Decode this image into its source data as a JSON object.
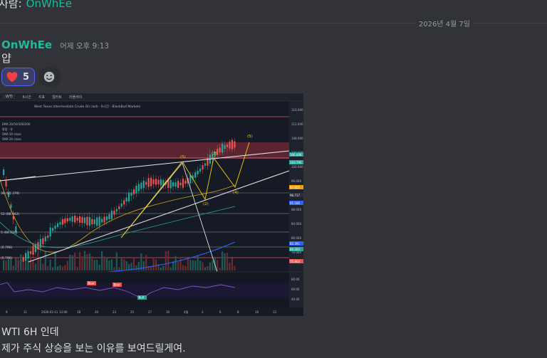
{
  "prev": {
    "text": "사람:",
    "username": "OnWhEe"
  },
  "divider": {
    "date": "2026년 4월 7일"
  },
  "message": {
    "username": "OnWhEe",
    "timestamp": "어제 오후 9:13",
    "text": "얍",
    "reactions": [
      {
        "emoji": "heart-icon",
        "count": "5"
      }
    ]
  },
  "chart": {
    "toolbar": {
      "symbol": "WTI",
      "interval": "6시간",
      "indicators": "지표",
      "alert": "얼러트",
      "replay": "리플레이"
    },
    "title": "West Texas Intermediate Crude Oil cash · 6시간 · BlackBull Markets",
    "indicator_labels": [
      "EMA 20/50/100/200",
      "통합 - 유",
      "SMA 50 close",
      "SMA 20 close"
    ],
    "wave_labels": [
      "(5)",
      "(5)",
      "(3)",
      "(4)",
      "(2)"
    ],
    "fib_labels": [
      "36 (95.379)",
      "52 (88.042)",
      "5 (84.616)",
      "(0.796)",
      "(0.796)"
    ],
    "price_ticks": [
      "116.000",
      "112.000",
      "108.000",
      "104.000",
      "100.000",
      "96.000",
      "92.000",
      "88.000",
      "84.000",
      "80.000",
      "76.000"
    ],
    "badge_prices": [
      "106.406",
      "103.795",
      "97.655",
      "96.717",
      "95.186",
      "82.391",
      "80.265",
      "75.864"
    ],
    "rsi_labels": [
      "Bear",
      "Bear",
      "Bull"
    ],
    "rsi_ticks": [
      "80.00",
      "60.00",
      "40.00"
    ],
    "time_ticks": [
      "9",
      "11",
      "2026-03-11",
      "13:00",
      "18",
      "20",
      "23",
      "25",
      "27",
      "30",
      "4월",
      "3",
      "6",
      "8",
      "10",
      "13"
    ]
  },
  "footer": {
    "line1": "WTI 6H 인데",
    "line2": "제가 주식 상승을 보는 이유를 보여드릴게여."
  },
  "colors": {
    "bg": "#313338",
    "username": "#1abc9c",
    "reaction_border": "#5865f2",
    "reaction_bg": "#3b3e66",
    "bull": "#26a69a",
    "bear": "#ef5350",
    "chart_bg": "#161a25"
  }
}
